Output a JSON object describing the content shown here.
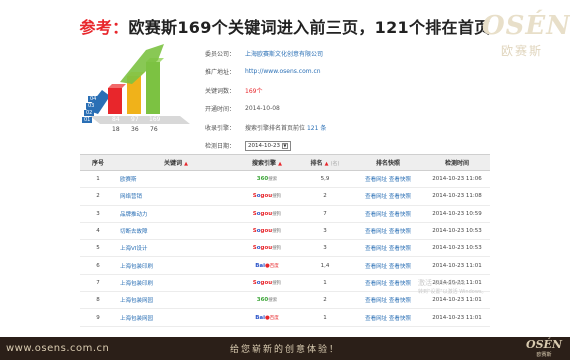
{
  "header": {
    "title_prefix": "参考：",
    "title_main": "欧赛斯169个关键词进入前三页，121个排在首页"
  },
  "logo": {
    "brand": "OSÉN",
    "brand_cn": "欧赛斯"
  },
  "chart": {
    "top_numbers": [
      "84",
      "97",
      "169"
    ],
    "bottom_numbers": [
      "18",
      "36",
      "76"
    ],
    "badges": [
      "04",
      "03",
      "02",
      "01"
    ],
    "colors": {
      "blue": "#2a6fb5",
      "red": "#e8262b",
      "yellow": "#f0b21a",
      "green": "#7cc242"
    }
  },
  "info": {
    "rows": [
      {
        "label": "委员公司：",
        "value": "上海欧赛斯文化创意有限公司"
      },
      {
        "label": "推广地址：",
        "value": "http://www.osens.com.cn"
      },
      {
        "label": "关键词数：",
        "value": "169个"
      },
      {
        "label": "开通时间：",
        "value": "2014-10-08"
      },
      {
        "label": "收录引擎：",
        "value_prefix": "搜索引擎排名首页前位",
        "value_num": "121",
        "value_suffix": "条"
      },
      {
        "label": "检测日期：",
        "date": "2014-10-23"
      }
    ]
  },
  "table": {
    "headers": [
      "序号",
      "关键词",
      "搜索引擎",
      "排名",
      "排名快照",
      "检测时间"
    ],
    "header_sort": "▲",
    "rank_muted": "(名)",
    "rows": [
      {
        "no": "1",
        "keyword": "欧赛斯",
        "engine": "360",
        "engine_tag": "搜索",
        "rank": "5,9",
        "link1": "查看网址",
        "link2": "查看快照",
        "time": "2014-10-23 11:06"
      },
      {
        "no": "2",
        "keyword": "网络营销",
        "engine": "sogou",
        "engine_tag": "搜狗",
        "rank": "2",
        "link1": "查看网址",
        "link2": "查看快照",
        "time": "2014-10-23 11:08"
      },
      {
        "no": "3",
        "keyword": "品牌推动力",
        "engine": "sogou",
        "engine_tag": "搜狗",
        "rank": "7",
        "link1": "查看网址",
        "link2": "查看快照",
        "time": "2014-10-23 10:59"
      },
      {
        "no": "4",
        "keyword": "切断去故障",
        "engine": "sogou",
        "engine_tag": "搜狗",
        "rank": "3",
        "link1": "查看网址",
        "link2": "查看快照",
        "time": "2014-10-23 10:53"
      },
      {
        "no": "5",
        "keyword": "上海VI设计",
        "engine": "sogou",
        "engine_tag": "搜狗",
        "rank": "3",
        "link1": "查看网址",
        "link2": "查看快照",
        "time": "2014-10-23 10:53"
      },
      {
        "no": "6",
        "keyword": "上海包装印刷",
        "engine": "baidu",
        "engine_tag": "百度",
        "rank": "1,4",
        "link1": "查看网址",
        "link2": "查看快照",
        "time": "2014-10-23 11:01"
      },
      {
        "no": "7",
        "keyword": "上海包装印刷",
        "engine": "sogou",
        "engine_tag": "搜狗",
        "rank": "1",
        "link1": "查看网址",
        "link2": "查看快照",
        "time": "2014-10-23 11:01"
      },
      {
        "no": "8",
        "keyword": "上海包装网园",
        "engine": "360",
        "engine_tag": "搜索",
        "rank": "2",
        "link1": "查看网址",
        "link2": "查看快照",
        "time": "2014-10-23 11:01"
      },
      {
        "no": "9",
        "keyword": "上海包装网园",
        "engine": "baidu",
        "engine_tag": "百度",
        "rank": "1",
        "link1": "查看网址",
        "link2": "查看快照",
        "time": "2014-10-23 11:01"
      }
    ]
  },
  "watermark": {
    "line1": "激活 Windows",
    "line2": "转到\"设置\"以激活 Windows。"
  },
  "footer": {
    "url": "www.osens.com.cn",
    "slogan": "给您崭新的创意体验！",
    "brand": "OSÉN",
    "brand_cn": "欧赛斯"
  }
}
